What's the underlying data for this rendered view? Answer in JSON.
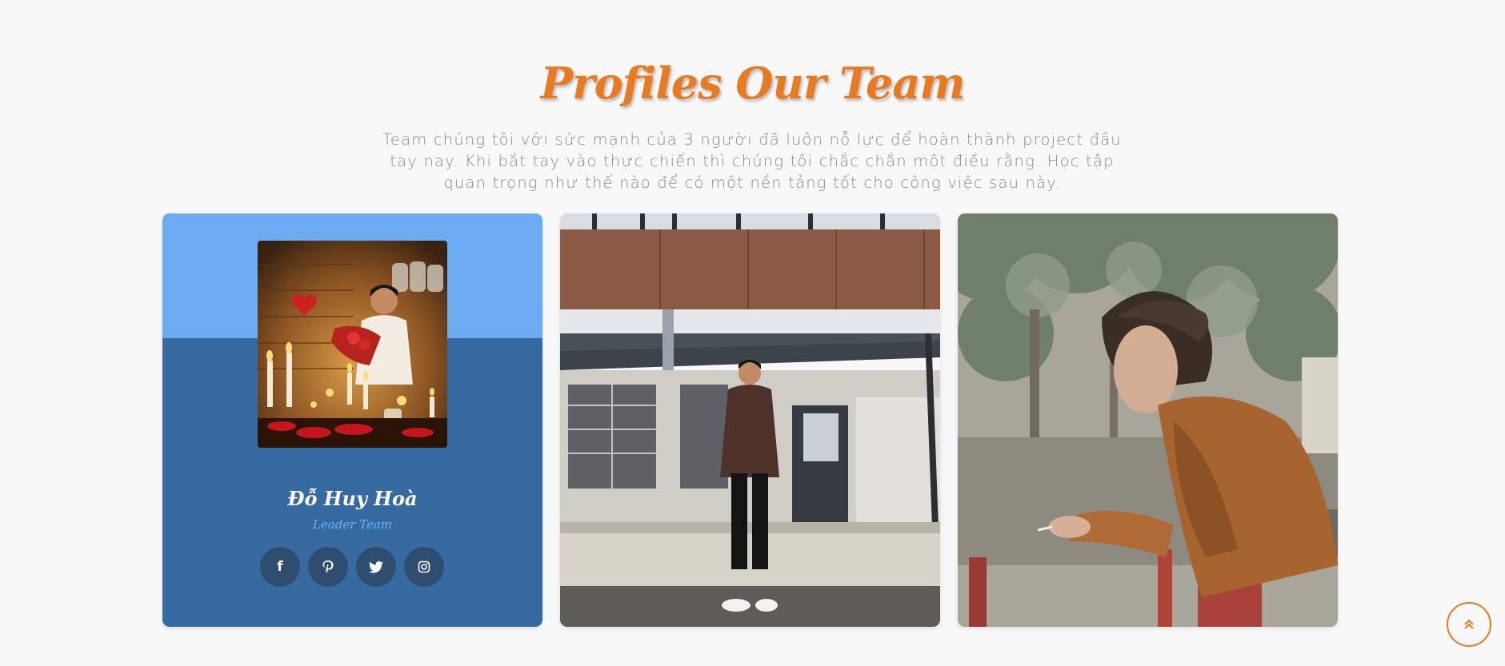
{
  "section": {
    "title": "Profiles Our Team",
    "subtitle": "Team chúng tôi với sức mạnh của 3 người đã luôn nỗ lực để hoàn thành project đầu tay nay. Khi bắt tay vào thực chiến thì chúng tôi chắc chắn một điều rằng. Học tập quan trọng như thế nào để có một nền tảng tốt cho công việc sau này."
  },
  "cards": [
    {
      "name": "Đỗ Huy Hoà",
      "role": "Leader Team",
      "socials": [
        {
          "icon": "facebook-icon",
          "glyph": "f"
        },
        {
          "icon": "pinterest-icon",
          "glyph": "P"
        },
        {
          "icon": "twitter-icon",
          "glyph": ""
        },
        {
          "icon": "instagram-icon",
          "glyph": ""
        }
      ]
    },
    {
      "photo": "man-standing-in-front-of-building"
    },
    {
      "photo": "man-in-brown-jacket-leaning-on-railing"
    }
  ],
  "colors": {
    "accent": "#e87a1f",
    "card_band_light": "#6aabf1",
    "card_body": "#366aa0",
    "social_button": "#2f4d6f",
    "role_text": "#6ab0f5",
    "subtitle_text": "#8a8a8a",
    "page_bg": "#f8f8f8"
  },
  "scroll_top": {
    "icon": "double-chevron-up-icon"
  }
}
